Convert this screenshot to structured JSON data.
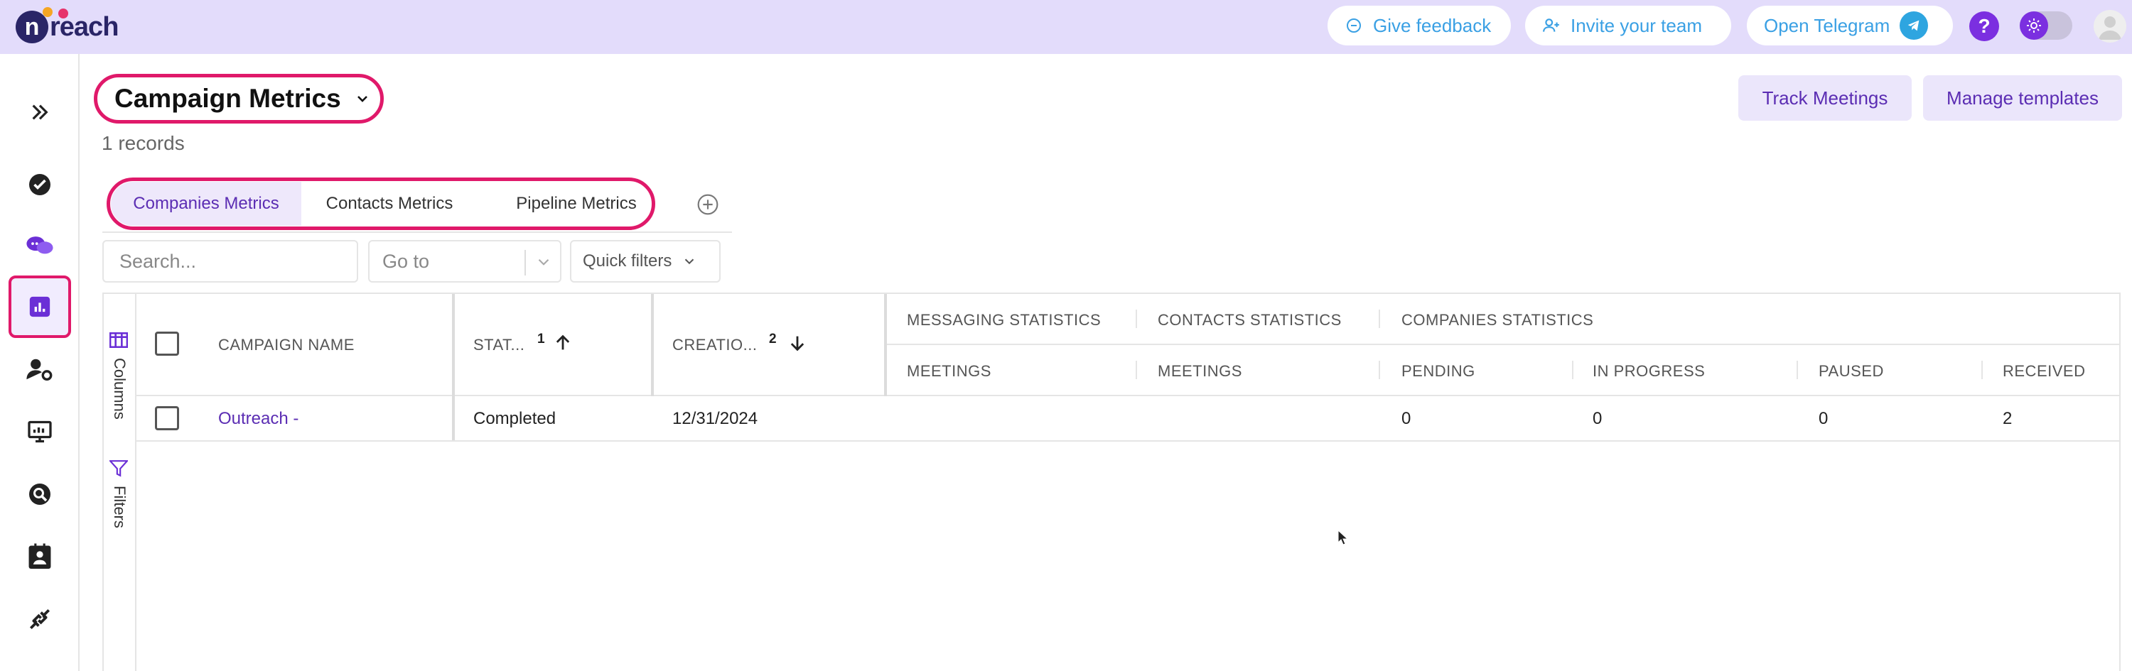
{
  "app": {
    "logo_text": "reach",
    "logo_letter": "n"
  },
  "topbar": {
    "feedback": "Give feedback",
    "invite": "Invite your team",
    "telegram": "Open Telegram",
    "help": "?"
  },
  "sidebar": {
    "items": [
      {
        "icon": "expand-icon"
      },
      {
        "icon": "check-circle-icon"
      },
      {
        "icon": "chat-icon"
      },
      {
        "icon": "chart-icon",
        "active": true
      },
      {
        "icon": "user-settings-icon"
      },
      {
        "icon": "presentation-icon"
      },
      {
        "icon": "search-icon"
      },
      {
        "icon": "contact-card-icon"
      },
      {
        "icon": "integrations-icon"
      }
    ]
  },
  "page": {
    "title": "Campaign Metrics",
    "records": "1 records",
    "track_meetings": "Track Meetings",
    "manage_templates": "Manage templates"
  },
  "tabs": [
    {
      "label": "Companies Metrics",
      "active": true
    },
    {
      "label": "Contacts Metrics",
      "active": false
    },
    {
      "label": "Pipeline Metrics",
      "active": false
    }
  ],
  "filters": {
    "search_placeholder": "Search...",
    "goto_placeholder": "Go to",
    "quick_filters": "Quick filters"
  },
  "side_tools": {
    "columns": "Columns",
    "filters": "Filters"
  },
  "table": {
    "group_headers": [
      "MESSAGING STATISTICS",
      "CONTACTS STATISTICS",
      "COMPANIES STATISTICS"
    ],
    "columns": {
      "name": "CAMPAIGN NAME",
      "status": "STAT...",
      "status_sort": "1",
      "created": "CREATIO...",
      "created_sort": "2",
      "msg_meetings": "MEETINGS",
      "contacts_meetings": "MEETINGS",
      "pending": "PENDING",
      "in_progress": "IN PROGRESS",
      "paused": "PAUSED",
      "received": "RECEIVED"
    },
    "rows": [
      {
        "name": "Outreach -",
        "status": "Completed",
        "created": "12/31/2024",
        "msg_meetings": "",
        "contacts_meetings": "",
        "pending": "0",
        "in_progress": "0",
        "paused": "0",
        "received": "2"
      }
    ]
  }
}
